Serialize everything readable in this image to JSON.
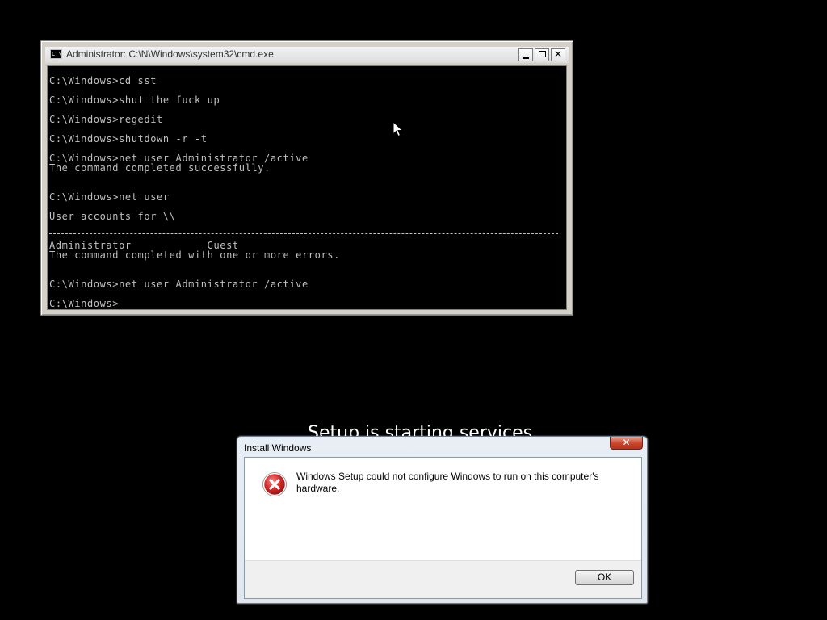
{
  "background": {
    "status_text": "Setup is starting services"
  },
  "cmd": {
    "title": "Administrator: C:\\N\\Windows\\system32\\cmd.exe",
    "icon": "cmd-app-icon",
    "icon_glyph": "C:\\",
    "controls": {
      "minimize": "minimize-icon",
      "maximize": "maximize-icon",
      "close": "close-icon",
      "close_glyph": "✕"
    },
    "lines": [
      "C:\\Windows>cd sst",
      "",
      "C:\\Windows>shut the fuck up",
      "",
      "C:\\Windows>regedit",
      "",
      "C:\\Windows>shutdown -r -t",
      "",
      "C:\\Windows>net user Administrator /active",
      "The command completed successfully.",
      "",
      "",
      "C:\\Windows>net user",
      "",
      "User accounts for \\\\",
      "",
      "",
      "Administrator            Guest",
      "The command completed with one or more errors.",
      "",
      "",
      "C:\\Windows>net user Administrator /active",
      "",
      "C:\\Windows>"
    ]
  },
  "dialog": {
    "title": "Install Windows",
    "close_glyph": "✕",
    "icon": "error-icon",
    "message": "Windows Setup could not configure Windows to run on this computer's hardware.",
    "ok_label": "OK"
  },
  "colors": {
    "console_bg": "#000000",
    "console_text": "#c0c0c0",
    "error_red": "#d62a2a"
  }
}
